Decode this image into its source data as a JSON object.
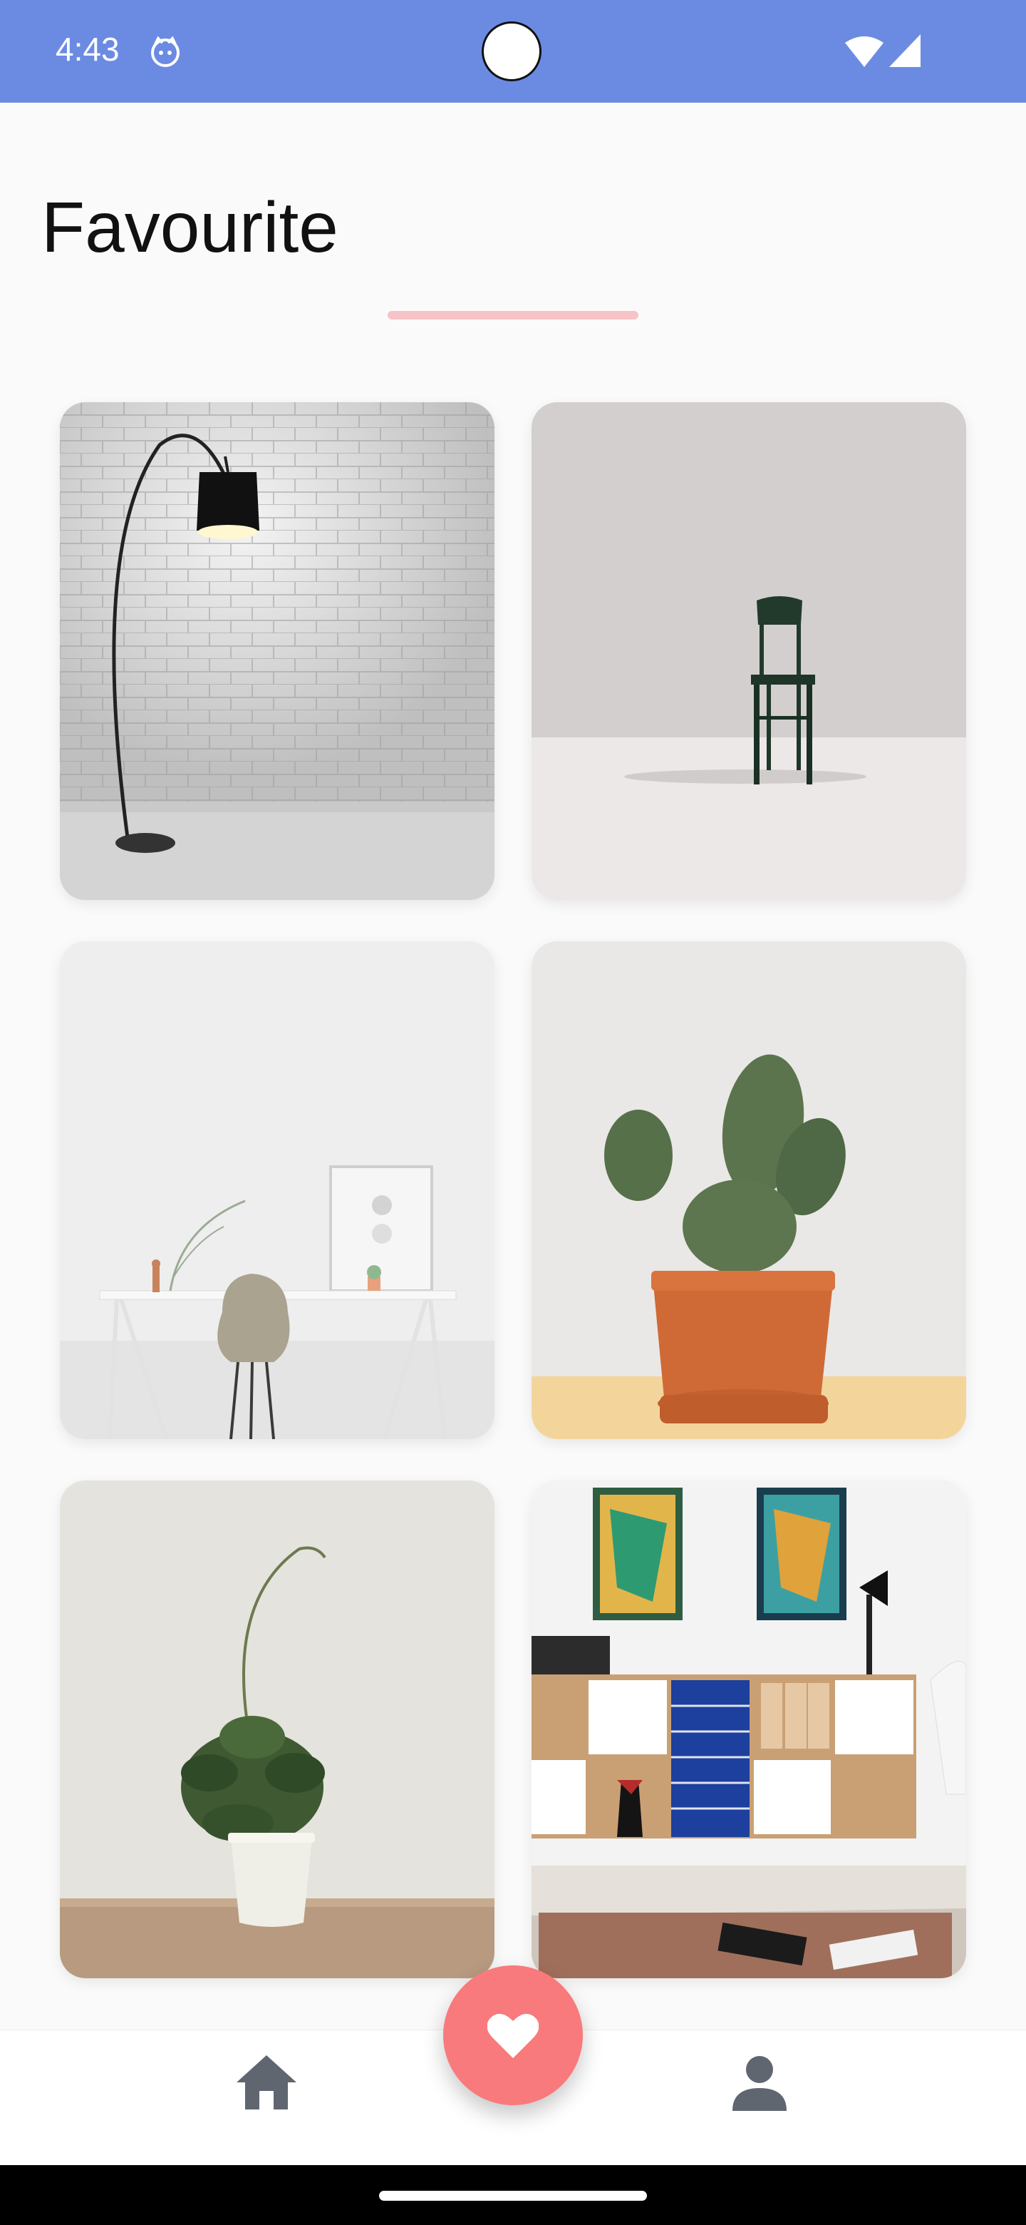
{
  "status_bar": {
    "time": "4:43",
    "app_icon": "cat-face-icon",
    "wifi_icon": "wifi-icon",
    "signal_icon": "cellular-signal-icon",
    "color": "#6b8be3"
  },
  "header": {
    "title": "Favourite",
    "underline_color": "#f7c3c7"
  },
  "favourites": [
    {
      "name": "floor-lamp",
      "icon": "floor-lamp-image"
    },
    {
      "name": "green-chair",
      "icon": "chair-image"
    },
    {
      "name": "white-desk",
      "icon": "desk-image"
    },
    {
      "name": "cactus",
      "icon": "cactus-image"
    },
    {
      "name": "potted-plant",
      "icon": "potted-plant-image"
    },
    {
      "name": "storage-cabinet",
      "icon": "cabinet-image"
    }
  ],
  "bottom_nav": {
    "home_icon": "home-icon",
    "favourite_icon": "heart-icon",
    "profile_icon": "person-icon",
    "fab_color": "#f87a7c"
  }
}
